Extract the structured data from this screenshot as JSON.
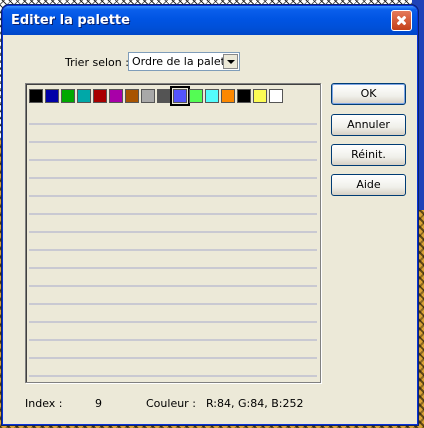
{
  "dialog": {
    "title": "Editer la palette",
    "sort": {
      "label": "Trier selon :",
      "selected": "Ordre de la palette"
    },
    "palette": {
      "swatches": [
        {
          "color": "#000000"
        },
        {
          "color": "#0000a8"
        },
        {
          "color": "#00a800"
        },
        {
          "color": "#00a8a8"
        },
        {
          "color": "#a80000"
        },
        {
          "color": "#a800a8"
        },
        {
          "color": "#a85400"
        },
        {
          "color": "#a8a8a8"
        },
        {
          "color": "#545454"
        },
        {
          "color": "#5454fc",
          "selected": true
        },
        {
          "color": "#54fc54"
        },
        {
          "color": "#54fcfc"
        },
        {
          "color": "#fc8800"
        },
        {
          "color": "#000000"
        },
        {
          "color": "#fcfc54"
        },
        {
          "color": "#ffffff"
        }
      ]
    },
    "buttons": {
      "ok": "OK",
      "cancel": "Annuler",
      "reset": "Réinit.",
      "help": "Aide"
    },
    "status": {
      "index_label": "Index :",
      "index_value": "9",
      "color_label": "Couleur :",
      "color_value": "R:84, G:84, B:252"
    }
  }
}
